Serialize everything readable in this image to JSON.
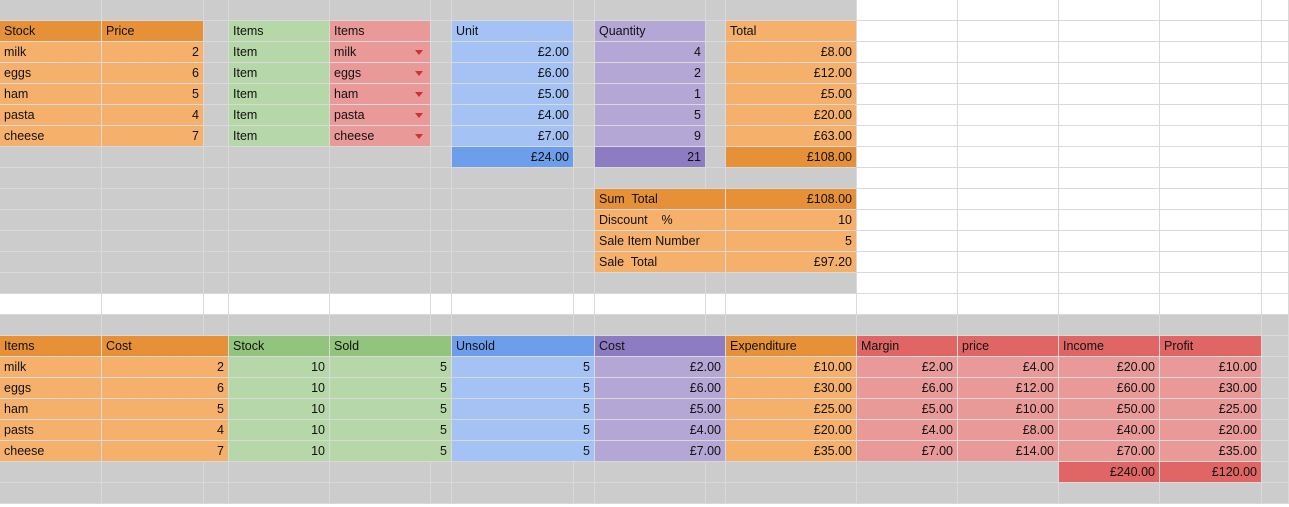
{
  "colors": {
    "grey": "#cccccc",
    "orange": "#f5b06b",
    "orange_dark": "#e69138",
    "green": "#b6d7a8",
    "green_dark": "#93c47d",
    "red": "#ea9999",
    "red_dark": "#e06666",
    "blue": "#a4c2f4",
    "blue_dark": "#6d9eeb",
    "purple": "#b4a7d6",
    "purple_dark": "#8e7cc3"
  },
  "top": {
    "stock_header": "Stock",
    "price_header": "Price",
    "items_header_1": "Items",
    "items_header_2": "Items",
    "unit_header": "Unit",
    "quantity_header": "Quantity",
    "total_header": "Total",
    "rows": [
      {
        "stock": "milk",
        "price": "2",
        "item": "Item",
        "select": "milk",
        "unit": "£2.00",
        "qty": "4",
        "total": "£8.00"
      },
      {
        "stock": "eggs",
        "price": "6",
        "item": "Item",
        "select": "eggs",
        "unit": "£6.00",
        "qty": "2",
        "total": "£12.00"
      },
      {
        "stock": "ham",
        "price": "5",
        "item": "Item",
        "select": "ham",
        "unit": "£5.00",
        "qty": "1",
        "total": "£5.00"
      },
      {
        "stock": "pasta",
        "price": "4",
        "item": "Item",
        "select": "pasta",
        "unit": "£4.00",
        "qty": "5",
        "total": "£20.00"
      },
      {
        "stock": "cheese",
        "price": "7",
        "item": "Item",
        "select": "cheese",
        "unit": "£7.00",
        "qty": "9",
        "total": "£63.00"
      }
    ],
    "unit_sum": "£24.00",
    "qty_sum": "21",
    "total_sum": "£108.00"
  },
  "summary": {
    "sum_total_label": "Sum  Total",
    "sum_total_value": "£108.00",
    "discount_label": "Discount    %",
    "discount_value": "10",
    "sale_item_label": "Sale Item Number",
    "sale_item_value": "5",
    "sale_total_label": "Sale  Total",
    "sale_total_value": "£97.20"
  },
  "bottom": {
    "headers": [
      "Items",
      "Cost",
      "Stock",
      "Sold",
      "Unsold",
      "Cost",
      "Expenditure",
      "Margin",
      "price",
      "Income",
      "Profit"
    ],
    "rows": [
      [
        "milk",
        "2",
        "10",
        "5",
        "5",
        "£2.00",
        "£10.00",
        "£2.00",
        "£4.00",
        "£20.00",
        "£10.00"
      ],
      [
        "eggs",
        "6",
        "10",
        "5",
        "5",
        "£6.00",
        "£30.00",
        "£6.00",
        "£12.00",
        "£60.00",
        "£30.00"
      ],
      [
        "ham",
        "5",
        "10",
        "5",
        "5",
        "£5.00",
        "£25.00",
        "£5.00",
        "£10.00",
        "£50.00",
        "£25.00"
      ],
      [
        "pasts",
        "4",
        "10",
        "5",
        "5",
        "£4.00",
        "£20.00",
        "£4.00",
        "£8.00",
        "£40.00",
        "£20.00"
      ],
      [
        "cheese",
        "7",
        "10",
        "5",
        "5",
        "£7.00",
        "£35.00",
        "£7.00",
        "£14.00",
        "£70.00",
        "£35.00"
      ]
    ],
    "income_sum": "£240.00",
    "profit_sum": "£120.00"
  }
}
